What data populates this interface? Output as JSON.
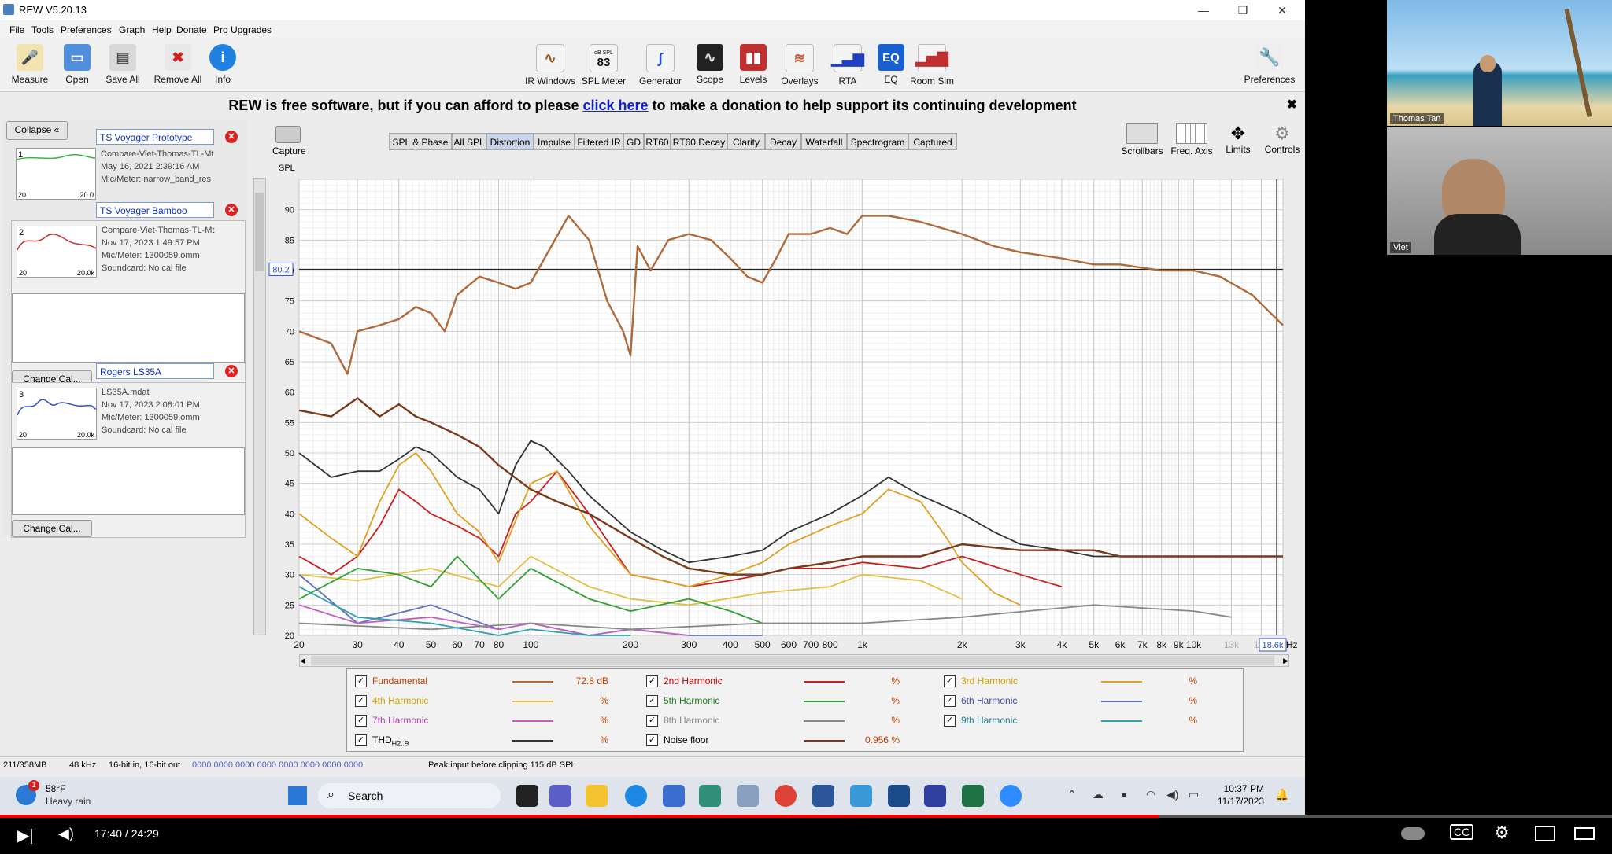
{
  "window": {
    "title": "REW V5.20.13"
  },
  "menu": [
    "File",
    "Tools",
    "Preferences",
    "Graph",
    "Help",
    "Donate",
    "Pro Upgrades"
  ],
  "toolbar_left": [
    {
      "label": "Measure",
      "icon": "microphone-icon"
    },
    {
      "label": "Open",
      "icon": "folder-icon"
    },
    {
      "label": "Save All",
      "icon": "save-icon"
    },
    {
      "label": "Remove All",
      "icon": "remove-icon"
    },
    {
      "label": "Info",
      "icon": "info-icon"
    }
  ],
  "toolbar_center": [
    {
      "label": "IR Windows",
      "icon": "ir-windows-icon"
    },
    {
      "label": "SPL Meter",
      "icon": "spl-meter-icon",
      "top": "dB SPL",
      "value": "83"
    },
    {
      "label": "Generator",
      "icon": "generator-icon"
    },
    {
      "label": "Scope",
      "icon": "scope-icon"
    },
    {
      "label": "Levels",
      "icon": "levels-icon"
    },
    {
      "label": "Overlays",
      "icon": "overlays-icon"
    },
    {
      "label": "RTA",
      "icon": "rta-icon"
    },
    {
      "label": "EQ",
      "icon": "eq-icon"
    },
    {
      "label": "Room Sim",
      "icon": "room-sim-icon"
    }
  ],
  "toolbar_right": {
    "label": "Preferences",
    "icon": "wrench-icon"
  },
  "donate": {
    "before": "REW is free software, but if you can afford to please ",
    "link": "click here",
    "after": " to make a donation to help support its continuing development"
  },
  "left_panel": {
    "collapse": "Collapse",
    "change_cal": "Change Cal...",
    "measurements": [
      {
        "num": "1",
        "name": "TS Voyager Prototype",
        "file": "Compare-Viet-Thomas-TL-Mt",
        "date": "May 16, 2021 2:39:16 AM",
        "mic": "Mic/Meter: narrow_band_res",
        "sound": "",
        "color": "#3cb43c",
        "axis_lo": "20",
        "axis_hi": "20.0"
      },
      {
        "num": "2",
        "name": "TS Voyager Bamboo",
        "file": "Compare-Viet-Thomas-TL-Mt",
        "date": "Nov 17, 2023 1:49:57 PM",
        "mic": "Mic/Meter: 1300059.omm",
        "sound": "Soundcard: No cal file",
        "color": "#d03030",
        "axis_lo": "20",
        "axis_hi": "20.0k"
      },
      {
        "num": "3",
        "name": "Rogers LS35A",
        "file": "LS35A.mdat",
        "date": "Nov 17, 2023 2:08:01 PM",
        "mic": "Mic/Meter: 1300059.omm",
        "sound": "Soundcard: No cal file",
        "color": "#3050d0",
        "axis_lo": "20",
        "axis_hi": "20.0k"
      }
    ]
  },
  "graph_toolbar": {
    "capture": "Capture",
    "scrollbars": "Scrollbars",
    "freq_axis": "Freq. Axis",
    "limits": "Limits",
    "controls": "Controls"
  },
  "tabs": [
    "SPL & Phase",
    "All SPL",
    "Distortion",
    "Impulse",
    "Filtered IR",
    "GD",
    "RT60",
    "RT60 Decay",
    "Clarity",
    "Decay",
    "Waterfall",
    "Spectrogram",
    "Captured"
  ],
  "active_tab": "Distortion",
  "chart_data": {
    "type": "line",
    "ylabel": "SPL",
    "xlabel": "Hz",
    "x_scale": "log",
    "xlim": [
      20,
      18600
    ],
    "ylim": [
      20,
      95
    ],
    "y_ticks": [
      20,
      25,
      30,
      35,
      40,
      45,
      50,
      55,
      60,
      65,
      70,
      75,
      80,
      85,
      90
    ],
    "x_ticks": [
      "20",
      "30",
      "40",
      "50",
      "60",
      "70",
      "80",
      "100",
      "200",
      "300",
      "400",
      "500",
      "600",
      "700",
      "800",
      "1k",
      "2k",
      "3k",
      "4k",
      "5k",
      "6k",
      "7k",
      "8k",
      "9k",
      "10k",
      "13k",
      "16k",
      "18.6k"
    ],
    "x_tick_values": [
      20,
      30,
      40,
      50,
      60,
      70,
      80,
      100,
      200,
      300,
      400,
      500,
      600,
      700,
      800,
      1000,
      2000,
      3000,
      4000,
      5000,
      6000,
      7000,
      8000,
      9000,
      10000,
      13000,
      16000,
      18600
    ],
    "cursor_y": "80.2",
    "cursor_x": "18.6k",
    "series": [
      {
        "name": "Fundamental",
        "color": "#b06a3a",
        "x": [
          20,
          25,
          28,
          30,
          35,
          40,
          45,
          50,
          55,
          60,
          70,
          80,
          90,
          100,
          110,
          130,
          150,
          170,
          190,
          200,
          210,
          230,
          260,
          300,
          350,
          400,
          450,
          500,
          550,
          600,
          700,
          800,
          900,
          1000,
          1200,
          1500,
          2000,
          2500,
          3000,
          4000,
          5000,
          6000,
          8000,
          10000,
          12000,
          15000,
          18600
        ],
        "y": [
          70,
          68,
          63,
          70,
          71,
          72,
          74,
          73,
          70,
          76,
          79,
          78,
          77,
          78,
          82,
          89,
          85,
          75,
          70,
          66,
          84,
          80,
          85,
          86,
          85,
          82,
          79,
          78,
          82,
          86,
          86,
          87,
          86,
          89,
          89,
          88,
          86,
          84,
          83,
          82,
          81,
          81,
          80,
          80,
          79,
          76,
          71
        ]
      },
      {
        "name": "2nd Harmonic",
        "color": "#cc2020",
        "x": [
          20,
          25,
          30,
          35,
          40,
          45,
          50,
          60,
          70,
          80,
          90,
          100,
          120,
          150,
          200,
          250,
          300,
          400,
          500,
          600,
          800,
          1000,
          1500,
          2000,
          3000,
          4000
        ],
        "y": [
          33,
          30,
          33,
          38,
          44,
          42,
          40,
          38,
          36,
          33,
          40,
          42,
          47,
          40,
          30,
          29,
          28,
          29,
          30,
          31,
          31,
          32,
          31,
          33,
          30,
          28
        ]
      },
      {
        "name": "3rd Harmonic",
        "color": "#e0a020",
        "x": [
          20,
          25,
          30,
          35,
          40,
          45,
          50,
          60,
          70,
          80,
          100,
          120,
          150,
          200,
          250,
          300,
          400,
          500,
          600,
          800,
          1000,
          1200,
          1500,
          1800,
          2000,
          2500,
          3000
        ],
        "y": [
          40,
          36,
          33,
          42,
          48,
          50,
          47,
          40,
          37,
          32,
          45,
          47,
          38,
          30,
          29,
          28,
          30,
          32,
          35,
          38,
          40,
          44,
          42,
          36,
          32,
          27,
          25
        ]
      },
      {
        "name": "4th Harmonic",
        "color": "#e0c040",
        "x": [
          20,
          30,
          50,
          80,
          100,
          150,
          200,
          300,
          500,
          800,
          1000,
          1500,
          2000
        ],
        "y": [
          30,
          29,
          31,
          28,
          33,
          28,
          26,
          25,
          27,
          28,
          30,
          29,
          26
        ]
      },
      {
        "name": "5th Harmonic",
        "color": "#30a030",
        "x": [
          20,
          30,
          40,
          50,
          60,
          80,
          100,
          150,
          200,
          300,
          400,
          500
        ],
        "y": [
          26,
          31,
          30,
          28,
          33,
          26,
          31,
          26,
          24,
          26,
          24,
          22
        ]
      },
      {
        "name": "6th Harmonic",
        "color": "#6070c0",
        "x": [
          20,
          30,
          50,
          80,
          100,
          150,
          200,
          300,
          500
        ],
        "y": [
          30,
          22,
          25,
          21,
          22,
          20,
          21,
          20,
          20
        ]
      },
      {
        "name": "7th Harmonic",
        "color": "#c060c0",
        "x": [
          20,
          30,
          50,
          80,
          100,
          150,
          200,
          300
        ],
        "y": [
          25,
          22,
          23,
          21,
          22,
          20,
          21,
          20
        ]
      },
      {
        "name": "8th Harmonic",
        "color": "#888888",
        "x": [
          20,
          50,
          100,
          200,
          500,
          1000,
          2000,
          5000,
          10000,
          13000
        ],
        "y": [
          22,
          21,
          22,
          21,
          22,
          22,
          23,
          25,
          24,
          23
        ]
      },
      {
        "name": "9th Harmonic",
        "color": "#30a0b0",
        "x": [
          20,
          30,
          50,
          80,
          100,
          150,
          200
        ],
        "y": [
          28,
          23,
          22,
          20,
          21,
          20,
          20
        ]
      },
      {
        "name": "THD H2..9",
        "color": "#333333",
        "x": [
          20,
          25,
          30,
          35,
          40,
          45,
          50,
          60,
          70,
          80,
          90,
          100,
          110,
          130,
          150,
          200,
          250,
          300,
          400,
          500,
          600,
          800,
          1000,
          1200,
          1500,
          2000,
          2500,
          3000,
          4000,
          5000,
          6000
        ],
        "y": [
          50,
          46,
          47,
          47,
          49,
          51,
          50,
          46,
          44,
          40,
          48,
          52,
          51,
          47,
          43,
          37,
          34,
          32,
          33,
          34,
          37,
          40,
          43,
          46,
          43,
          40,
          37,
          35,
          34,
          33,
          33
        ]
      },
      {
        "name": "Noise floor",
        "color": "#7a3a1a",
        "x": [
          20,
          25,
          30,
          35,
          40,
          45,
          50,
          60,
          70,
          80,
          100,
          120,
          150,
          200,
          250,
          300,
          400,
          500,
          600,
          800,
          1000,
          1500,
          2000,
          3000,
          4000,
          5000,
          6000,
          8000,
          10000,
          12000,
          15000,
          18600
        ],
        "y": [
          57,
          56,
          59,
          56,
          58,
          56,
          55,
          53,
          51,
          48,
          44,
          42,
          40,
          36,
          33,
          31,
          30,
          30,
          31,
          32,
          33,
          33,
          35,
          34,
          34,
          34,
          33,
          33,
          33,
          33,
          33,
          33
        ]
      }
    ]
  },
  "legend": [
    {
      "name": "Fundamental",
      "color": "#b06a3a",
      "value": "72.8 dB",
      "name_color": "#c04000"
    },
    {
      "name": "2nd Harmonic",
      "color": "#cc2020",
      "value": "%",
      "name_color": "#c00000"
    },
    {
      "name": "3rd Harmonic",
      "color": "#e0a020",
      "value": "%",
      "name_color": "#d0a000"
    },
    {
      "name": "4th Harmonic",
      "color": "#e0c040",
      "value": "%",
      "name_color": "#d0a000"
    },
    {
      "name": "5th Harmonic",
      "color": "#30a030",
      "value": "%",
      "name_color": "#208020"
    },
    {
      "name": "6th Harmonic",
      "color": "#6070c0",
      "value": "%",
      "name_color": "#4050a0"
    },
    {
      "name": "7th Harmonic",
      "color": "#c060c0",
      "value": "%",
      "name_color": "#b040b0"
    },
    {
      "name": "8th Harmonic",
      "color": "#888888",
      "value": "%",
      "name_color": "#888888"
    },
    {
      "name": "9th Harmonic",
      "color": "#30a0b0",
      "value": "%",
      "name_color": "#208090"
    },
    {
      "name": "THD",
      "sub": "H2..9",
      "color": "#333333",
      "value": "%",
      "name_color": "#000000"
    },
    {
      "name": "Noise floor",
      "color": "#7a3a1a",
      "value": "0.956 %",
      "name_color": "#000000"
    }
  ],
  "status": {
    "mem": "211/358MB",
    "rate": "48 kHz",
    "bits": "16-bit in, 16-bit out",
    "levels": "0000 0000  0000 0000  0000 0000  0000 0000",
    "peak": "Peak input before clipping 115 dB SPL"
  },
  "taskbar": {
    "weather_temp": "58°F",
    "weather_desc": "Heavy rain",
    "weather_badge": "1",
    "search": "Search",
    "time": "10:37 PM",
    "date": "11/17/2023"
  },
  "video": {
    "time": "17:40 / 24:29",
    "progress": 0.7186,
    "play_icon": "play-next-icon"
  },
  "participants": [
    {
      "name": "Thomas Tan"
    },
    {
      "name": "Viet"
    }
  ]
}
